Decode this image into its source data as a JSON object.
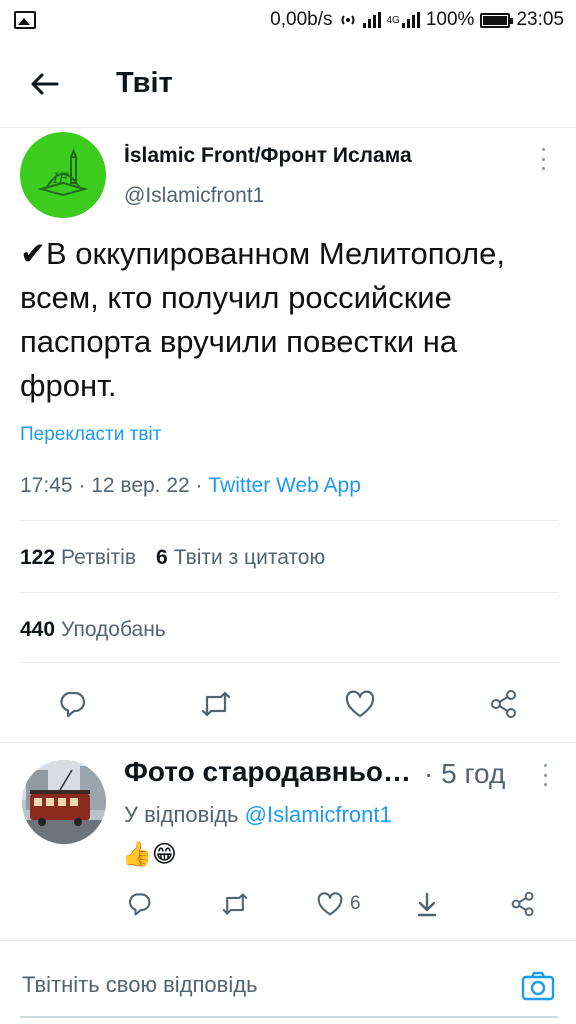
{
  "status_bar": {
    "network_speed": "0,00b/s",
    "network_type": "4G",
    "battery": "100%",
    "time": "23:05"
  },
  "header": {
    "title": "Твіт"
  },
  "tweet": {
    "author_name": "İslamic Front/Фронт Ислама",
    "author_handle": "@Islamicfront1",
    "text": "✔В оккупированном Мелитополе, всем, кто получил российские паспорта вручили повестки на фронт.",
    "translate_label": "Перекласти твіт",
    "time_date": "17:45 · 12 вер. 22 · ",
    "source": "Twitter Web App",
    "retweets_count": "122",
    "retweets_label": "Ретвітів",
    "quotes_count": "6",
    "quotes_label": "Твіти з цитатою",
    "likes_count": "440",
    "likes_label": "Уподобань"
  },
  "reply": {
    "author_name": "Фото стародавнього Киева",
    "time": "· 5 год",
    "replying_prefix": "У відповідь ",
    "replying_handle": "@Islamicfront1",
    "text": "👍😁",
    "likes_count": "6"
  },
  "composer": {
    "placeholder": "Твітніть свою відповідь"
  },
  "colors": {
    "accent": "#1d9bf0",
    "avatar_bg": "#3ccc1e",
    "muted": "#536471"
  }
}
